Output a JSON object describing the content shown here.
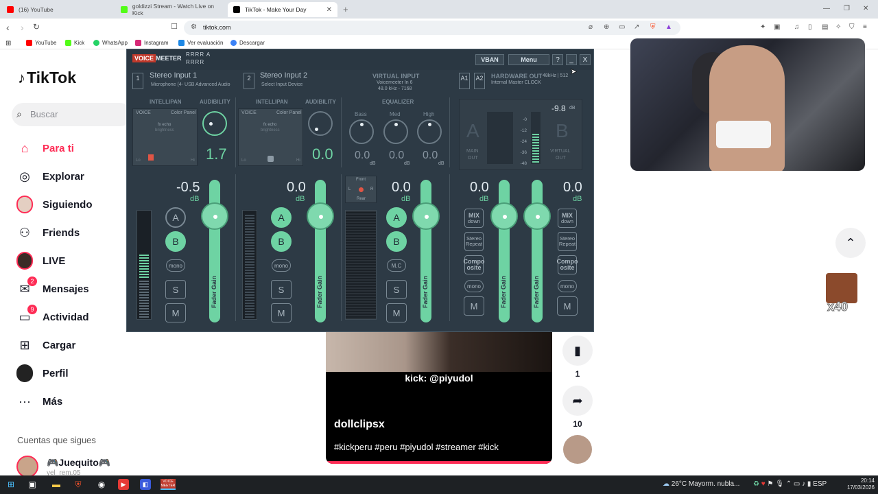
{
  "browser": {
    "tabs": [
      {
        "title": "(16) YouTube",
        "color": "#ff0000"
      },
      {
        "title": "goldizzi Stream - Watch Live on Kick",
        "color": "#53fc18"
      },
      {
        "title": "TikTok - Make Your Day",
        "color": "#000000"
      }
    ],
    "new_tab": "+",
    "url": "tiktok.com",
    "bookmarks": [
      {
        "label": "YouTube",
        "color": "#ff0000"
      },
      {
        "label": "Kick",
        "color": "#53fc18"
      },
      {
        "label": "WhatsApp",
        "color": "#25d366"
      },
      {
        "label": "Instagram",
        "color": "#d62976"
      },
      {
        "label": "Ver evaluación",
        "color": "#1e88e5"
      },
      {
        "label": "Descargar",
        "color": "#3b82f6"
      }
    ]
  },
  "tiktok": {
    "logo": "TikTok",
    "search_placeholder": "Buscar",
    "nav": [
      {
        "label": "Para ti",
        "icon": "home-icon"
      },
      {
        "label": "Explorar",
        "icon": "compass-icon"
      },
      {
        "label": "Siguiendo",
        "icon": "avatar-icon"
      },
      {
        "label": "Friends",
        "icon": "friends-icon"
      },
      {
        "label": "LIVE",
        "icon": "live-avatar-icon"
      },
      {
        "label": "Mensajes",
        "icon": "message-icon",
        "badge": "2"
      },
      {
        "label": "Actividad",
        "icon": "activity-icon",
        "badge": "9"
      },
      {
        "label": "Cargar",
        "icon": "upload-icon"
      },
      {
        "label": "Perfil",
        "icon": "profile-icon"
      },
      {
        "label": "Más",
        "icon": "more-icon"
      }
    ],
    "following_header": "Cuentas que sigues",
    "following": [
      {
        "name": "🎮Juequito🎮",
        "sub": "yel_rem.05"
      }
    ],
    "video": {
      "overlay_text": "kick: @piyudol",
      "author": "dollclipsx",
      "tags": "#kickperu #peru #piyudol #streamer #kick"
    },
    "actions": {
      "bookmark_count": "1",
      "share_count": "10"
    },
    "emote_label": "x40"
  },
  "voicemeeter": {
    "logo_a": "VOICE",
    "logo_b": "MEETER",
    "logo_rrrr": "RRRR A RRRR",
    "vban": "VBAN",
    "menu": "Menu",
    "help": "?",
    "minimize": "_",
    "close": "X",
    "strip1": {
      "num": "1",
      "name": "Stereo Input 1",
      "device": "Microphone (4- USB Advanced Audio",
      "intellipan": "INTELLIPAN",
      "audibility": "AUDIBILITY",
      "voice": "VOICE",
      "color_panel": "Color Panel",
      "fx": "fx echo",
      "bright": "brightness",
      "lo": "Lo",
      "hi": "Hi",
      "aud_value": "1.7",
      "db": "-0.5",
      "db_unit": "dB",
      "mono": "mono",
      "s": "S",
      "m": "M",
      "fader": "Fader Gain"
    },
    "strip2": {
      "num": "2",
      "name": "Stereo Input 2",
      "device": "Select Input Device",
      "intellipan": "INTELLIPAN",
      "audibility": "AUDIBILITY",
      "voice": "VOICE",
      "color_panel": "Color Panel",
      "fx": "fx echo",
      "bright": "brightness",
      "lo": "Lo",
      "hi": "Hi",
      "aud_value": "0.0",
      "db": "0.0",
      "db_unit": "dB",
      "mono": "mono",
      "s": "S",
      "m": "M",
      "fader": "Fader Gain"
    },
    "virtual": {
      "title": "VIRTUAL INPUT",
      "sub1": "Voicemeeter In 6",
      "sub2": "48.0 kHz - 7168",
      "equalizer": "EQUALIZER",
      "bass": "Bass",
      "med": "Med",
      "high": "High",
      "bass_val": "0.0",
      "med_val": "0.0",
      "high_val": "0.0",
      "db_unit": "dB",
      "front": "Front",
      "rear": "Rear",
      "l": "L",
      "r": "R",
      "db": "0.0",
      "mc": "M.C",
      "s": "S",
      "m": "M",
      "fader": "Fader Gain"
    },
    "hw": {
      "a1": "A1",
      "a2": "A2",
      "title": "HARDWARE OUT",
      "rate": "48kHz | 512",
      "clock": "Internal Master CLOCK",
      "level": "-9.8",
      "db_unit": "dB",
      "scale": [
        "-0",
        "-12",
        "-24",
        "-36",
        "-48"
      ],
      "main": "MAIN",
      "out": "OUT",
      "virtual": "VIRTUAL",
      "vout": "OUT",
      "big_a": "A",
      "big_b": "B",
      "mix": "MIX",
      "down": "down",
      "stereo": "Stereo",
      "repeat": "Repeat",
      "compo": "Compo",
      "site": "osite",
      "mono": "mono",
      "m": "M",
      "db_a": "0.0",
      "db_b": "0.0",
      "fader": "Fader Gain"
    },
    "btn_a": "A",
    "btn_b": "B"
  },
  "taskbar": {
    "weather": "26°C  Mayorm. nubla...",
    "lang": "ESP",
    "time": "20:14",
    "date": "17/03/2026",
    "app_label": "VOICE MEETER"
  }
}
